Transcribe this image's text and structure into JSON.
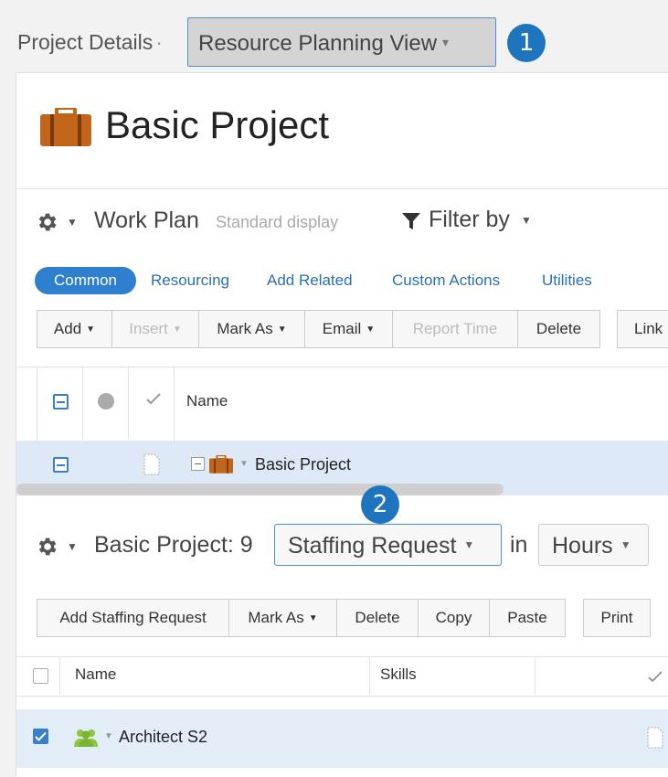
{
  "breadcrumb": {
    "parent": "Project Details",
    "separator": "·",
    "current": "Resource Planning View",
    "current_caret": "▾"
  },
  "badges": {
    "one": "1",
    "two": "2"
  },
  "project": {
    "title": "Basic Project",
    "icon": "briefcase-icon",
    "icon_color": "#c0651a"
  },
  "work_plan": {
    "title": "Work Plan",
    "subtitle": "Standard display",
    "filter_label": "Filter by",
    "tabs": {
      "common": "Common",
      "resourcing": "Resourcing",
      "add_related": "Add Related",
      "custom_actions": "Custom Actions",
      "utilities": "Utilities"
    },
    "toolbar": {
      "add": "Add",
      "insert": "Insert",
      "mark_as": "Mark As",
      "email": "Email",
      "report_time": "Report Time",
      "delete": "Delete",
      "link": "Link"
    },
    "grid": {
      "col_name": "Name",
      "rows": [
        {
          "name": "Basic Project"
        }
      ]
    }
  },
  "staffing": {
    "title": "Basic Project: 9",
    "view_select": "Staffing Request",
    "in_label": "in",
    "unit_select": "Hours",
    "toolbar": {
      "add_request": "Add Staffing Request",
      "mark_as": "Mark As",
      "delete": "Delete",
      "copy": "Copy",
      "paste": "Paste",
      "print": "Print"
    },
    "grid": {
      "col_name": "Name",
      "col_skills": "Skills",
      "rows": [
        {
          "name": "Architect S2",
          "checked": true
        }
      ]
    }
  },
  "colors": {
    "accent": "#2f7fcf",
    "badge": "#1e74bd",
    "link": "#2a6fb5",
    "selected_row": "#dde9f6",
    "people_icon": "#8dc63f"
  }
}
